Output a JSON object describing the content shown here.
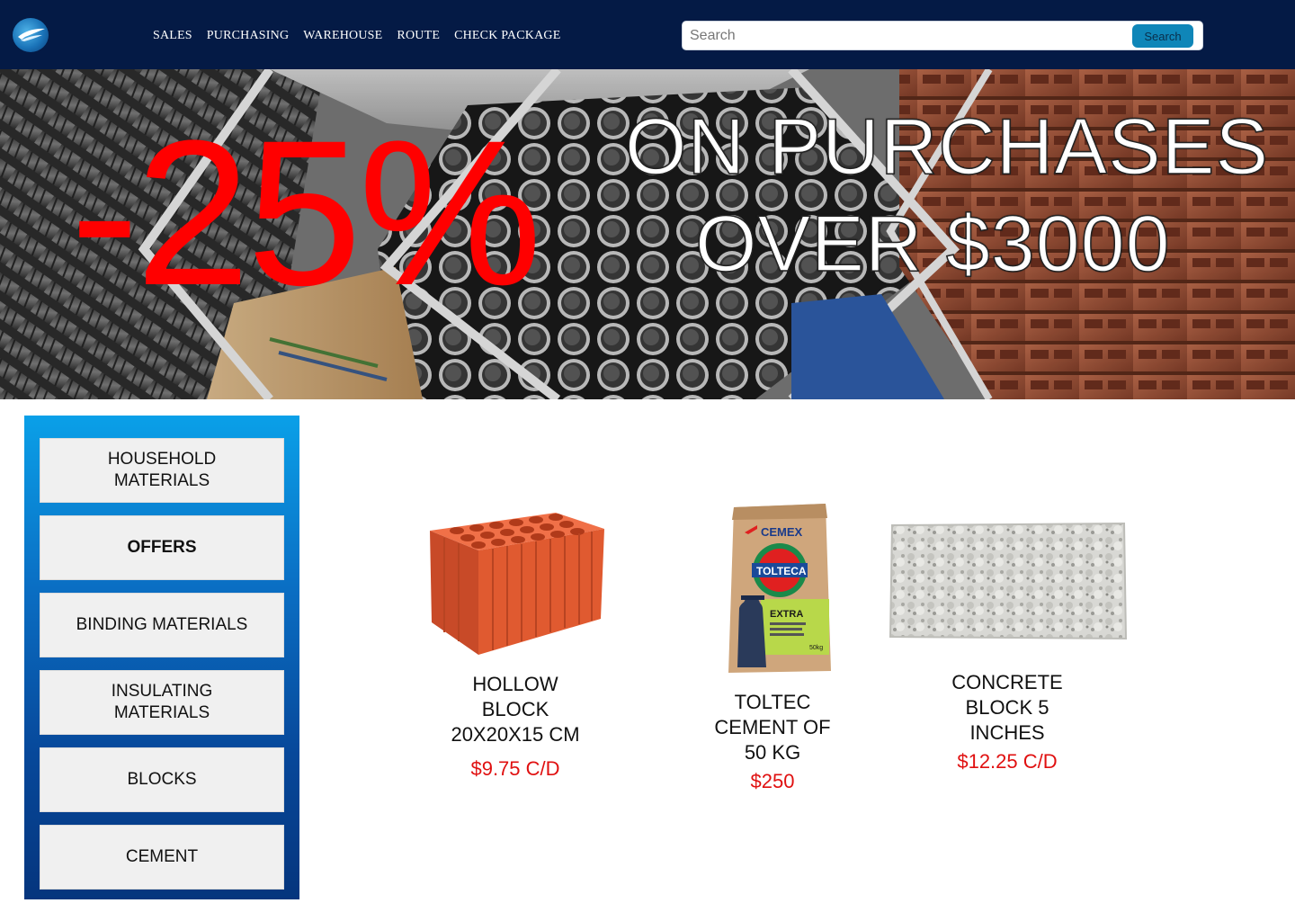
{
  "header": {
    "logo_icon": "bird-wing-icon",
    "nav": [
      {
        "label": "SALES"
      },
      {
        "label": "PURCHASING"
      },
      {
        "label": "WAREHOUSE"
      },
      {
        "label": "ROUTE"
      },
      {
        "label": "CHECK PACKAGE"
      }
    ],
    "search": {
      "placeholder": "Search",
      "value": "",
      "button_label": "Search"
    }
  },
  "banner": {
    "discount": "-25%",
    "line1": "ON PURCHASES",
    "line2": "OVER $3000",
    "discount_color": "#ff0000"
  },
  "sidebar": {
    "categories": [
      {
        "label": "HOUSEHOLD MATERIALS",
        "active": false
      },
      {
        "label": "OFFERS",
        "active": true
      },
      {
        "label": "BINDING MATERIALS",
        "active": false
      },
      {
        "label": "INSULATING MATERIALS",
        "active": false
      },
      {
        "label": "BLOCKS",
        "active": false
      },
      {
        "label": "CEMENT",
        "active": false
      }
    ]
  },
  "products": [
    {
      "name": "HOLLOW BLOCK 20X20X15 CM",
      "price": "$9.75 C/D",
      "image": "hollow-clay-block"
    },
    {
      "name": "TOLTEC CEMENT OF 50 KG",
      "price": "$250",
      "image": "cement-bag",
      "bag_text": {
        "brand": "CEMEX",
        "product": "TOLTECA",
        "variant": "EXTRA",
        "weight": "50kg"
      }
    },
    {
      "name": "CONCRETE BLOCK 5 INCHES",
      "price": "$12.25 C/D",
      "image": "concrete-block"
    }
  ],
  "colors": {
    "header_bg": "#041a45",
    "price": "#e01010",
    "search_button": "#0f86b8"
  }
}
